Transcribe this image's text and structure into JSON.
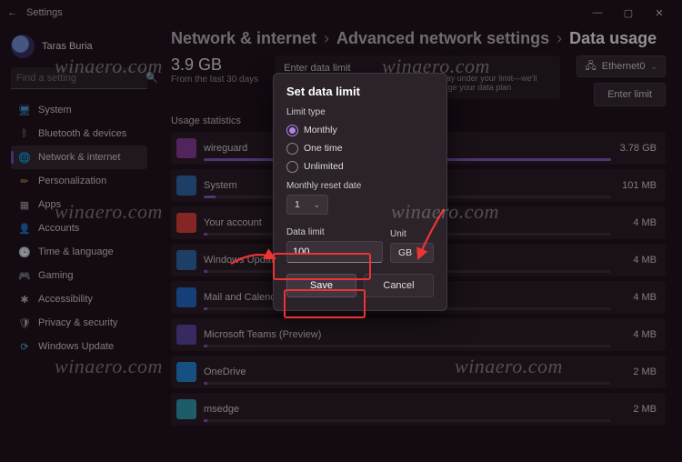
{
  "window": {
    "title": "Settings"
  },
  "user": {
    "name": "Taras Buria"
  },
  "search": {
    "placeholder": "Find a setting"
  },
  "sidebar": {
    "items": [
      {
        "icon": "🖥",
        "label": "System",
        "color": "#4aa3df"
      },
      {
        "icon": "ᛒ",
        "label": "Bluetooth & devices",
        "color": "#bbb"
      },
      {
        "icon": "🌐",
        "label": "Network & internet",
        "color": "#6fb7ff",
        "active": true
      },
      {
        "icon": "✏",
        "label": "Personalization",
        "color": "#d8a24a"
      },
      {
        "icon": "▦",
        "label": "Apps",
        "color": "#bbb"
      },
      {
        "icon": "👤",
        "label": "Accounts",
        "color": "#bbb"
      },
      {
        "icon": "🕒",
        "label": "Time & language",
        "color": "#bbb"
      },
      {
        "icon": "🎮",
        "label": "Gaming",
        "color": "#bbb"
      },
      {
        "icon": "✱",
        "label": "Accessibility",
        "color": "#bbb"
      },
      {
        "icon": "🛡",
        "label": "Privacy & security",
        "color": "#bbb"
      },
      {
        "icon": "⟳",
        "label": "Windows Update",
        "color": "#5ac0ea"
      }
    ]
  },
  "breadcrumb": {
    "a": "Network & internet",
    "b": "Advanced network settings",
    "c": "Data usage"
  },
  "totals": {
    "value": "3.9 GB",
    "caption": "From the last 30 days"
  },
  "enter_limit": {
    "title": "Enter data limit",
    "desc": "Windows can help you track data usage to stay under your limit—we'll warn you when you're close, but it won't change your data plan",
    "button": "Enter limit"
  },
  "network_selector": {
    "icon": "🖧",
    "label": "Ethernet0"
  },
  "stats_header": "Usage statistics",
  "apps": [
    {
      "name": "wireguard",
      "value": "3.78 GB",
      "fill": 100,
      "bg": "#8b3fa3"
    },
    {
      "name": "System",
      "value": "101 MB",
      "fill": 3,
      "bg": "#2e6fb0"
    },
    {
      "name": "Your account",
      "value": "4 MB",
      "fill": 1,
      "bg": "#e8443a"
    },
    {
      "name": "Windows Update",
      "value": "4 MB",
      "fill": 1,
      "bg": "#2e6fb0"
    },
    {
      "name": "Mail and Calendar",
      "value": "4 MB",
      "fill": 1,
      "bg": "#1f6fd0"
    },
    {
      "name": "Microsoft Teams (Preview)",
      "value": "4 MB",
      "fill": 1,
      "bg": "#5a4aa8"
    },
    {
      "name": "OneDrive",
      "value": "2 MB",
      "fill": 1,
      "bg": "#1f8fe0"
    },
    {
      "name": "msedge",
      "value": "2 MB",
      "fill": 1,
      "bg": "#2fa4b8"
    }
  ],
  "dialog": {
    "title": "Set data limit",
    "limit_type_label": "Limit type",
    "options": {
      "monthly": "Monthly",
      "one_time": "One time",
      "unlimited": "Unlimited"
    },
    "reset_label": "Monthly reset date",
    "reset_value": "1",
    "data_limit_label": "Data limit",
    "data_limit_value": "100",
    "unit_label": "Unit",
    "unit_value": "GB",
    "save": "Save",
    "cancel": "Cancel"
  },
  "watermark": "winaero.com"
}
